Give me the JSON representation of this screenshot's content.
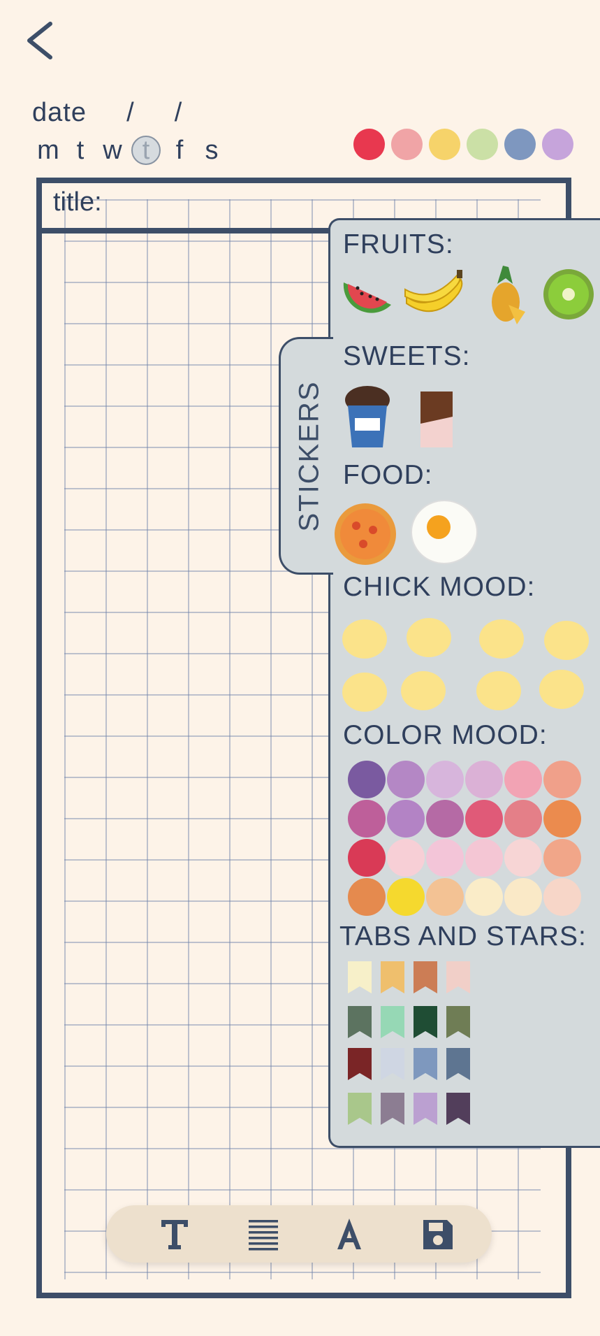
{
  "header": {
    "back_icon": "chevron-left-icon",
    "date_label": "date",
    "date_separator": "/",
    "weekdays": [
      "m",
      "t",
      "w",
      "t",
      "f",
      "s"
    ],
    "selected_weekday": 3,
    "moods": [
      {
        "name": "angry-mood",
        "color": "#e8384f"
      },
      {
        "name": "sad-mood",
        "color": "#f0a4a6"
      },
      {
        "name": "happy-mood",
        "color": "#f6d36a"
      },
      {
        "name": "sleepy-mood",
        "color": "#cbe0a6"
      },
      {
        "name": "worried-mood",
        "color": "#7e97bf"
      },
      {
        "name": "anxious-mood",
        "color": "#c6a4db"
      }
    ]
  },
  "page": {
    "title_label": "title:"
  },
  "stickers": {
    "tab_label": "STICKERS",
    "fruits_label": "FRUITS:",
    "fruits": [
      "watermelon",
      "banana",
      "pineapple",
      "kiwi"
    ],
    "sweets_label": "SWEETS:",
    "sweets": [
      "ice-cream",
      "chocolate-bar"
    ],
    "food_label": "FOOD:",
    "food": [
      "pizza",
      "fried-egg"
    ],
    "chick_label": "CHICK MOOD:",
    "chicks": [
      "crying",
      "neutral",
      "sparkle-thumbs-up",
      "confused",
      "excited",
      "love",
      "nervous",
      "sleeping"
    ],
    "color_mood_label": "COLOR MOOD:",
    "color_moods": [
      "#7a5aa0",
      "#b487c5",
      "#d7b5dc",
      "#dbb1d6",
      "#f2a3b4",
      "#f0a08a",
      "#be5f9a",
      "#b383c5",
      "#b56aa5",
      "#e05a78",
      "#e47f88",
      "#eb8b4e",
      "#d93a56",
      "#f7cfd6",
      "#f3c5d8",
      "#f4c6d4",
      "#f7d5d5",
      "#f1a689",
      "#e58a4e",
      "#f5d92e",
      "#f3c294",
      "#faecc8",
      "#fae9c7",
      "#f7d6c8"
    ],
    "tabs_label": "TABS AND STARS:",
    "flags": [
      "#f7f0c9",
      "#efbf6d",
      "#cc7d55",
      "#f1cfc8",
      "#5c7360",
      "#96d8b5",
      "#1f4d34",
      "#6f7d55",
      "#7a2526",
      "#cfd6e3",
      "#7e98be",
      "#5e7591",
      "#a9c78b",
      "#8c7d92",
      "#bba0d1",
      "#523e5b"
    ]
  },
  "toolbar": {
    "tools": [
      "text-icon",
      "paragraph-icon",
      "font-icon",
      "save-icon"
    ]
  }
}
